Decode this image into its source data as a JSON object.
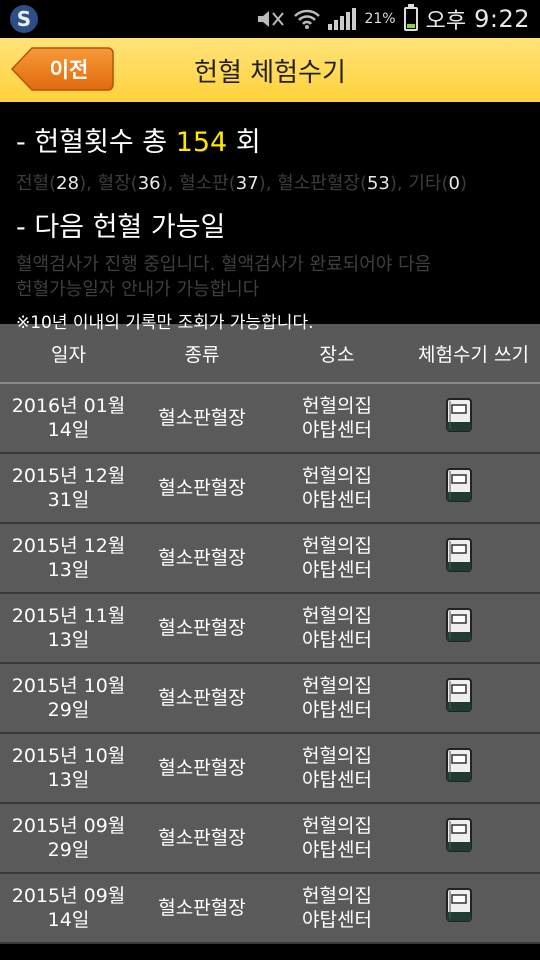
{
  "status_bar": {
    "battery": "21%",
    "ampm": "오후",
    "time": "9:22"
  },
  "header": {
    "back_label": "이전",
    "title": "헌혈 체험수기"
  },
  "summary": {
    "line1_prefix": "- 헌혈횟수 총",
    "total_count": "154",
    "line1_suffix": "회",
    "breakdown": [
      {
        "label": "전혈(",
        "value": "28",
        "close": "), "
      },
      {
        "label": "혈장(",
        "value": "36",
        "close": "), "
      },
      {
        "label": "혈소판(",
        "value": "37",
        "close": "), "
      },
      {
        "label": "혈소판혈장(",
        "value": "53",
        "close": "), "
      },
      {
        "label": "기타(",
        "value": "0",
        "close": ")"
      }
    ],
    "line2": "- 다음 헌혈 가능일",
    "notice_1": "혈액검사가 진행 중입니다. 혈액검사가 완료되어야 다음",
    "notice_2": "헌혈가능일자 안내가 가능합니다",
    "limit_notice": "※10년 이내의 기록만 조회가 가능합니다."
  },
  "table": {
    "headers": [
      "일자",
      "종류",
      "장소",
      "체험수기 쓰기"
    ],
    "rows": [
      {
        "date_1": "2016년 01월",
        "date_2": "14일",
        "type": "혈소판혈장",
        "place_1": "헌혈의집",
        "place_2": "야탑센터"
      },
      {
        "date_1": "2015년 12월",
        "date_2": "31일",
        "type": "혈소판혈장",
        "place_1": "헌혈의집",
        "place_2": "야탑센터"
      },
      {
        "date_1": "2015년 12월",
        "date_2": "13일",
        "type": "혈소판혈장",
        "place_1": "헌혈의집",
        "place_2": "야탑센터"
      },
      {
        "date_1": "2015년 11월",
        "date_2": "13일",
        "type": "혈소판혈장",
        "place_1": "헌혈의집",
        "place_2": "야탑센터"
      },
      {
        "date_1": "2015년 10월",
        "date_2": "29일",
        "type": "혈소판혈장",
        "place_1": "헌혈의집",
        "place_2": "야탑센터"
      },
      {
        "date_1": "2015년 10월",
        "date_2": "13일",
        "type": "혈소판혈장",
        "place_1": "헌혈의집",
        "place_2": "야탑센터"
      },
      {
        "date_1": "2015년 09월",
        "date_2": "29일",
        "type": "혈소판혈장",
        "place_1": "헌혈의집",
        "place_2": "야탑센터"
      },
      {
        "date_1": "2015년 09월",
        "date_2": "14일",
        "type": "혈소판혈장",
        "place_1": "헌혈의집",
        "place_2": "야탑센터"
      }
    ]
  },
  "icons": {
    "app": "blood-donation-app-icon",
    "write_note": "notebook-icon"
  },
  "colors": {
    "header_bg": "#ffd84d",
    "back_button": "#ee7a16",
    "count_highlight": "#ffe600",
    "table_bg": "#5a5a5a"
  }
}
